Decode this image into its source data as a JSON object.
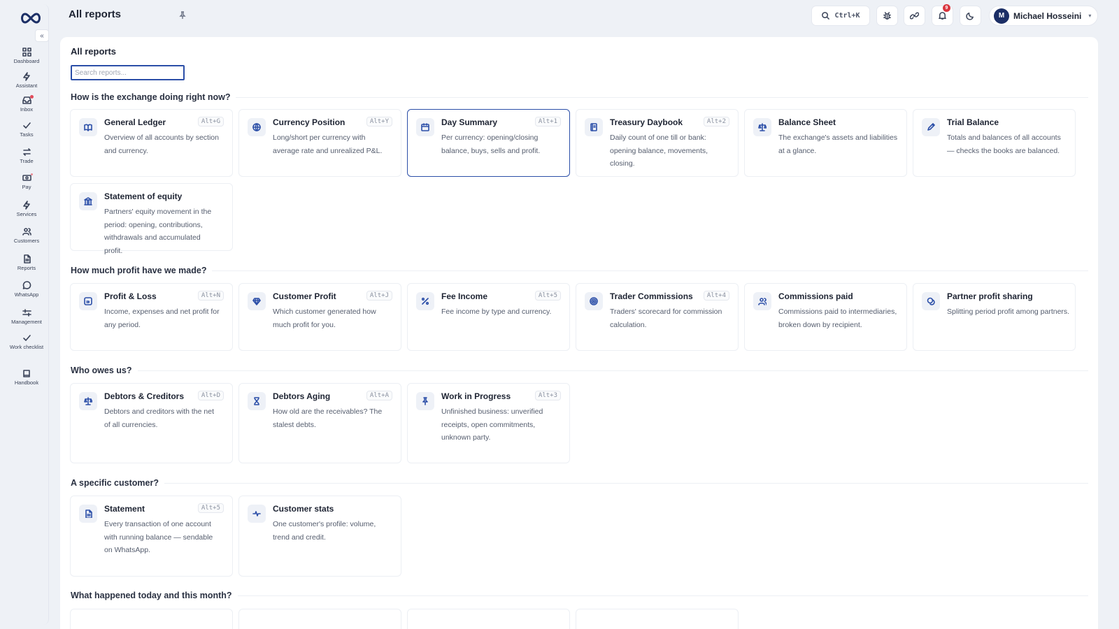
{
  "sidebar": {
    "collapse_icon": "«",
    "items": [
      {
        "label": "Dashboard",
        "icon": "grid-icon"
      },
      {
        "label": "Assistant",
        "icon": "bolt-icon"
      },
      {
        "label": "Inbox",
        "icon": "inbox-icon",
        "dot": true
      },
      {
        "label": "Tasks",
        "icon": "check-icon"
      },
      {
        "label": "Trade",
        "icon": "swap-icon"
      },
      {
        "label": "Pay",
        "icon": "cash-icon",
        "dot_small": true
      },
      {
        "label": "Services",
        "icon": "bolt-icon"
      },
      {
        "label": "Customers",
        "icon": "users-icon"
      },
      {
        "label": "Reports",
        "icon": "file-icon"
      },
      {
        "label": "WhatsApp",
        "icon": "chat-icon"
      },
      {
        "label": "Management",
        "icon": "sliders-icon"
      },
      {
        "label": "Work checklist",
        "icon": "check-icon"
      },
      {
        "label": "Handbook",
        "icon": "book-icon"
      }
    ]
  },
  "header": {
    "title": "All reports",
    "search_shortcut": "Ctrl+K",
    "notification_count": "9",
    "user": {
      "initial": "M",
      "name": "Michael Hosseini",
      "caret": "▾"
    }
  },
  "main": {
    "title": "All reports",
    "search_placeholder": "Search reports...",
    "sections": [
      {
        "heading": "How is the exchange doing right now?",
        "cards": [
          {
            "title": "General Ledger",
            "desc": "Overview of all accounts by section and currency.",
            "shortcut": "Alt+G",
            "icon": "book-open-icon"
          },
          {
            "title": "Currency Position",
            "desc": "Long/short per currency with average rate and unrealized P&L.",
            "shortcut": "Alt+Y",
            "icon": "globe-icon"
          },
          {
            "title": "Day Summary",
            "desc": "Per currency: opening/closing balance, buys, sells and profit.",
            "shortcut": "Alt+1",
            "icon": "calendar-icon",
            "active": true
          },
          {
            "title": "Treasury Daybook",
            "desc": "Daily count of one till or bank: opening balance, movements, closing.",
            "shortcut": "Alt+2",
            "icon": "ledger-icon"
          },
          {
            "title": "Balance Sheet",
            "desc": "The exchange's assets and liabilities at a glance.",
            "shortcut": "",
            "icon": "scale-icon"
          },
          {
            "title": "Trial Balance",
            "desc": "Totals and balances of all accounts — checks the books are balanced.",
            "shortcut": "",
            "icon": "pencil-icon"
          },
          {
            "title": "Statement of equity",
            "desc": "Partners' equity movement in the period: opening, contributions, withdrawals and accumulated profit.",
            "shortcut": "",
            "icon": "bank-icon"
          }
        ]
      },
      {
        "heading": "How much profit have we made?",
        "cards": [
          {
            "title": "Profit & Loss",
            "desc": "Income, expenses and net profit for any period.",
            "shortcut": "Alt+N",
            "icon": "report-icon"
          },
          {
            "title": "Customer Profit",
            "desc": "Which customer generated how much profit for you.",
            "shortcut": "Alt+J",
            "icon": "gem-icon"
          },
          {
            "title": "Fee Income",
            "desc": "Fee income by type and currency.",
            "shortcut": "Alt+5",
            "icon": "percent-icon"
          },
          {
            "title": "Trader Commissions",
            "desc": "Traders' scorecard for commission calculation.",
            "shortcut": "Alt+4",
            "icon": "target-icon"
          },
          {
            "title": "Commissions paid",
            "desc": "Commissions paid to intermediaries, broken down by recipient.",
            "shortcut": "",
            "icon": "users-icon"
          },
          {
            "title": "Partner profit sharing",
            "desc": "Splitting period profit among partners.",
            "shortcut": "",
            "icon": "coins-icon"
          }
        ]
      },
      {
        "heading": "Who owes us?",
        "cards": [
          {
            "title": "Debtors & Creditors",
            "desc": "Debtors and creditors with the net of all currencies.",
            "shortcut": "Alt+D",
            "icon": "scale-icon"
          },
          {
            "title": "Debtors Aging",
            "desc": "How old are the receivables? The stalest debts.",
            "shortcut": "Alt+A",
            "icon": "hourglass-icon"
          },
          {
            "title": "Work in Progress",
            "desc": "Unfinished business: unverified receipts, open commitments, unknown party.",
            "shortcut": "Alt+3",
            "icon": "pin-icon"
          }
        ]
      },
      {
        "heading": "A specific customer?",
        "cards": [
          {
            "title": "Statement",
            "desc": "Every transaction of one account with running balance — sendable on WhatsApp.",
            "shortcut": "Alt+5",
            "icon": "file-icon"
          },
          {
            "title": "Customer stats",
            "desc": "One customer's profile: volume, trend and credit.",
            "shortcut": "",
            "icon": "pulse-icon"
          }
        ]
      },
      {
        "heading": "What happened today and this month?",
        "cards": []
      }
    ]
  },
  "colors": {
    "accent": "#2c4fa8",
    "badge": "#d9353f",
    "avatar": "#1c2f66"
  }
}
